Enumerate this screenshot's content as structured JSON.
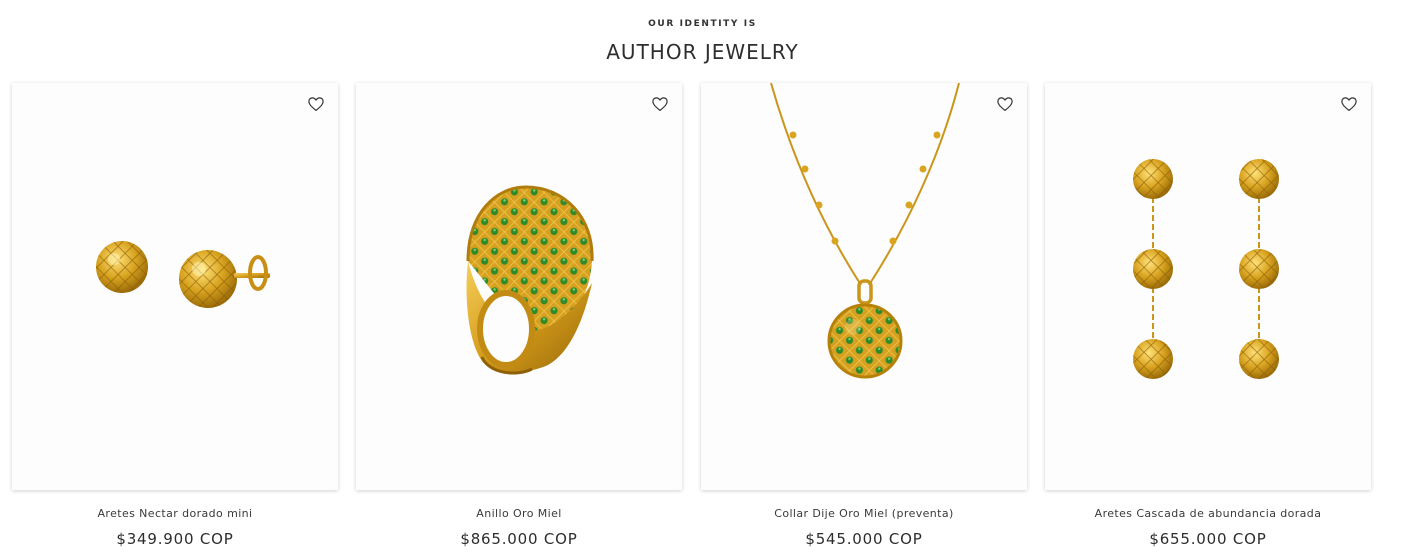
{
  "section": {
    "eyebrow": "OUR IDENTITY IS",
    "title": "AUTHOR JEWELRY"
  },
  "colors": {
    "gold": "#d9a420",
    "gold_dark": "#a8760a",
    "emerald": "#2f8a2a"
  },
  "products": [
    {
      "name": "Aretes Nectar dorado mini",
      "price": "$349.900 COP",
      "image_icon": "stud-earrings-image",
      "wishlist_icon": "heart-outline-icon"
    },
    {
      "name": "Anillo Oro Miel",
      "price": "$865.000 COP",
      "image_icon": "dome-ring-image",
      "wishlist_icon": "heart-outline-icon"
    },
    {
      "name": "Collar Dije Oro Miel (preventa)",
      "price": "$545.000 COP",
      "image_icon": "pendant-necklace-image",
      "wishlist_icon": "heart-outline-icon"
    },
    {
      "name": "Aretes Cascada de abundancia dorada",
      "price": "$655.000 COP",
      "image_icon": "drop-earrings-image",
      "wishlist_icon": "heart-outline-icon"
    }
  ]
}
